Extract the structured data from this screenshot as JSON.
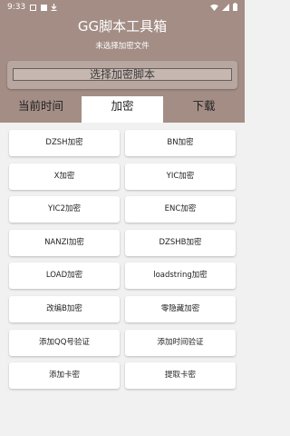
{
  "status_bar": {
    "time": "9:33",
    "icons": [
      "notification-icon",
      "image-icon",
      "download-icon"
    ],
    "right_icons": [
      "wifi-icon",
      "signal-icon",
      "battery-icon"
    ]
  },
  "header": {
    "title": "GG脚本工具箱",
    "subtitle": "未选择加密文件",
    "select_button": "选择加密脚本"
  },
  "tabs": [
    {
      "label": "当前时间",
      "active": false
    },
    {
      "label": "加密",
      "active": true
    },
    {
      "label": "下载",
      "active": false
    }
  ],
  "actions": [
    "DZSH加密",
    "BN加密",
    "X加密",
    "YIC加密",
    "YIC2加密",
    "ENC加密",
    "NANZI加密",
    "DZSHB加密",
    "LOAD加密",
    "loadstring加密",
    "改编B加密",
    "零隐藏加密",
    "添加QQ号验证",
    "添加时间验证",
    "添加卡密",
    "提取卡密"
  ],
  "colors": {
    "header": "#a38d85",
    "button_bg": "#ffffff",
    "page_bg": "#f1f1f1"
  }
}
